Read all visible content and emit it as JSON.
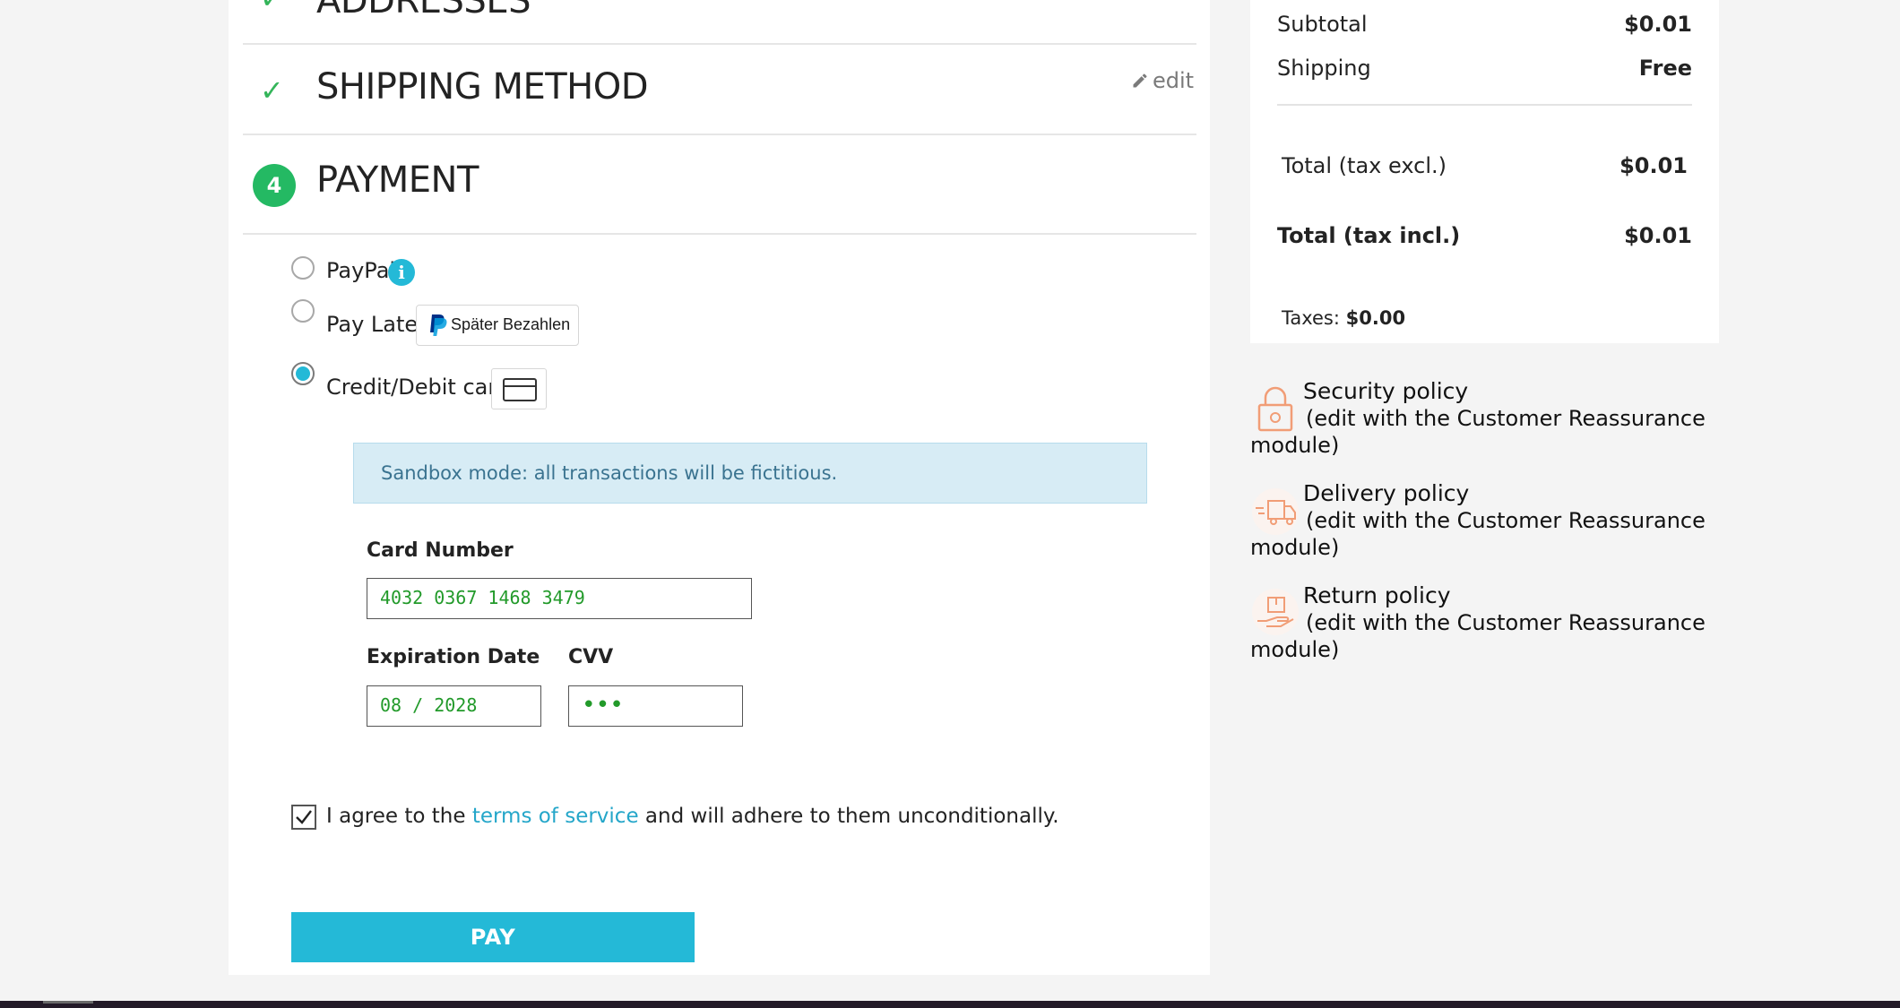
{
  "steps": {
    "addresses": {
      "title": "ADDRESSES"
    },
    "shipping": {
      "title": "SHIPPING METHOD",
      "edit_label": "edit"
    },
    "payment": {
      "number": "4",
      "title": "PAYMENT"
    }
  },
  "payment_options": [
    {
      "label": "PayPal",
      "selected": false,
      "info_icon": "i"
    },
    {
      "label": "Pay Later",
      "selected": false,
      "badge": "Später Bezahlen"
    },
    {
      "label": "Credit/Debit card",
      "selected": true
    }
  ],
  "sandbox_notice": "Sandbox mode: all transactions will be fictitious.",
  "card_form": {
    "card_number_label": "Card Number",
    "card_number_value": "4032 0367 1468 3479",
    "expiration_label": "Expiration Date",
    "expiration_value": "08 / 2028",
    "cvv_label": "CVV",
    "cvv_value": "•••"
  },
  "terms": {
    "checked": true,
    "prefix": "I agree to the ",
    "link": "terms of service",
    "suffix": " and will adhere to them unconditionally."
  },
  "pay_button_label": "PAY",
  "summary": {
    "subtotal_label": "Subtotal",
    "subtotal_value": "$0.01",
    "shipping_label": "Shipping",
    "shipping_value": "Free",
    "total_excl_label": "Total (tax excl.)",
    "total_excl_value": "$0.01",
    "total_incl_label": "Total (tax incl.)",
    "total_incl_value": "$0.01",
    "taxes_label": "Taxes:",
    "taxes_value": "$0.00"
  },
  "reassurance": [
    {
      "icon": "lock-icon",
      "title": "Security policy",
      "description": "(edit with the Customer Reassurance module)"
    },
    {
      "icon": "delivery-truck-icon",
      "title": "Delivery policy",
      "description": "(edit with the Customer Reassurance module)"
    },
    {
      "icon": "return-box-icon",
      "title": "Return policy",
      "description": "(edit with the Customer Reassurance module)"
    }
  ],
  "colors": {
    "accent": "#24b9d7",
    "success": "#24b963",
    "checkmark": "#34b55a",
    "input_text": "#229a2a",
    "reassurance_icon": "#f19d76",
    "alert_bg": "#d7ecf5"
  }
}
